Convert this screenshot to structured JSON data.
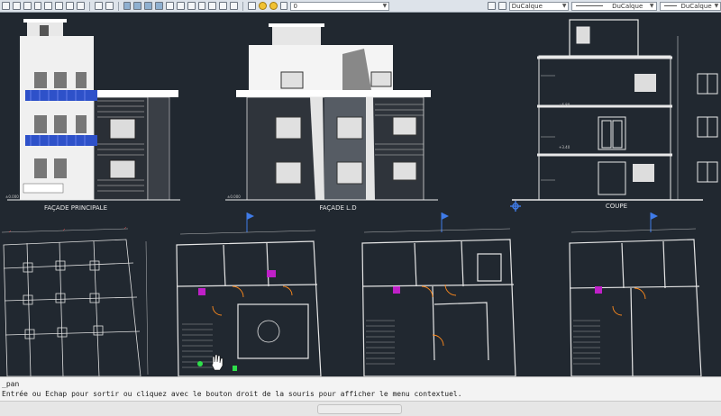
{
  "toolbar": {
    "layer_value": "0",
    "color_value": "DuCalque",
    "linetype_value": "DuCalque",
    "lineweight_value": "DuCalque"
  },
  "drawing": {
    "elevations": [
      {
        "title": "FAÇADE PRINCIPALE"
      },
      {
        "title": "FAÇADE L.D"
      },
      {
        "title": "COUPE"
      }
    ],
    "levels": {
      "base": "±0.000",
      "l1": "+3.40",
      "l2": "+6.80"
    }
  },
  "command": {
    "last": "_pan",
    "prompt": "Entrée ou Echap pour sortir ou cliquez avec le bouton droit de la souris pour afficher le menu contextuel."
  }
}
